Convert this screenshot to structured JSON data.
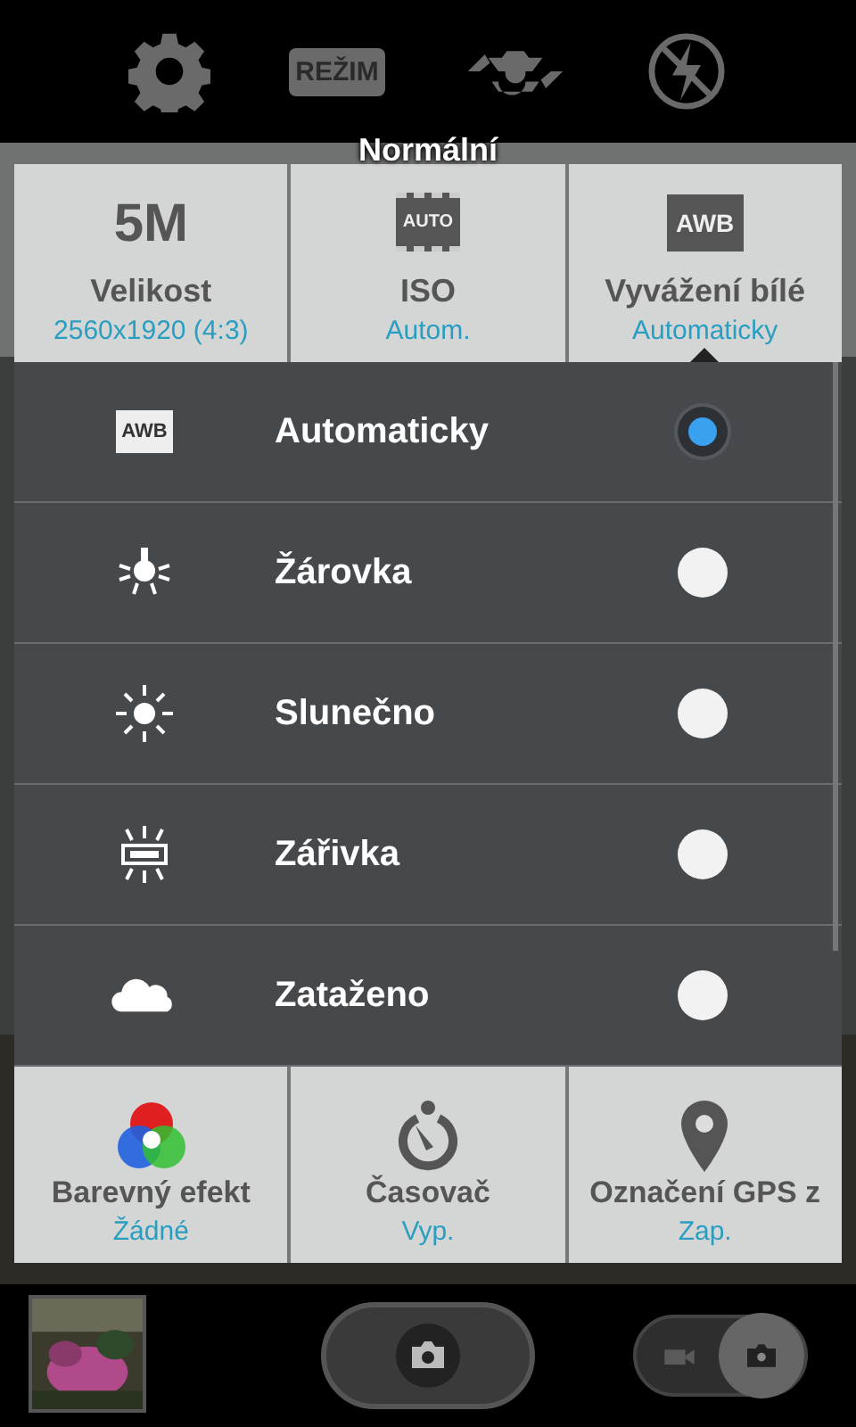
{
  "top_bar": {
    "mode_button": "REŽIM"
  },
  "mode_label": "Normální",
  "capture_toggle": {
    "photo_selected": true
  },
  "settings_top": [
    {
      "kind": "size",
      "icon_text": "5M",
      "label": "Velikost",
      "value": "2560x1920 (4:3)",
      "selected": false
    },
    {
      "kind": "iso",
      "icon_text": "AUTO",
      "label": "ISO",
      "value": "Autom.",
      "selected": false
    },
    {
      "kind": "awb",
      "icon_text": "AWB",
      "label": "Vyvážení bílé",
      "value": "Automaticky",
      "selected": true
    }
  ],
  "options": [
    {
      "kind": "awb",
      "icon_text": "AWB",
      "label": "Automaticky",
      "selected": true
    },
    {
      "kind": "bulb",
      "label": "Žárovka",
      "selected": false
    },
    {
      "kind": "sun",
      "label": "Slunečno",
      "selected": false
    },
    {
      "kind": "fluorescent",
      "label": "Zářivka",
      "selected": false
    },
    {
      "kind": "cloud",
      "label": "Zataženo",
      "selected": false
    }
  ],
  "settings_bottom": [
    {
      "kind": "color",
      "label": "Barevný efekt",
      "value": "Žádné"
    },
    {
      "kind": "timer",
      "label": "Časovač",
      "value": "Vyp."
    },
    {
      "kind": "gps",
      "label": "Označení GPS z",
      "value": "Zap."
    }
  ]
}
